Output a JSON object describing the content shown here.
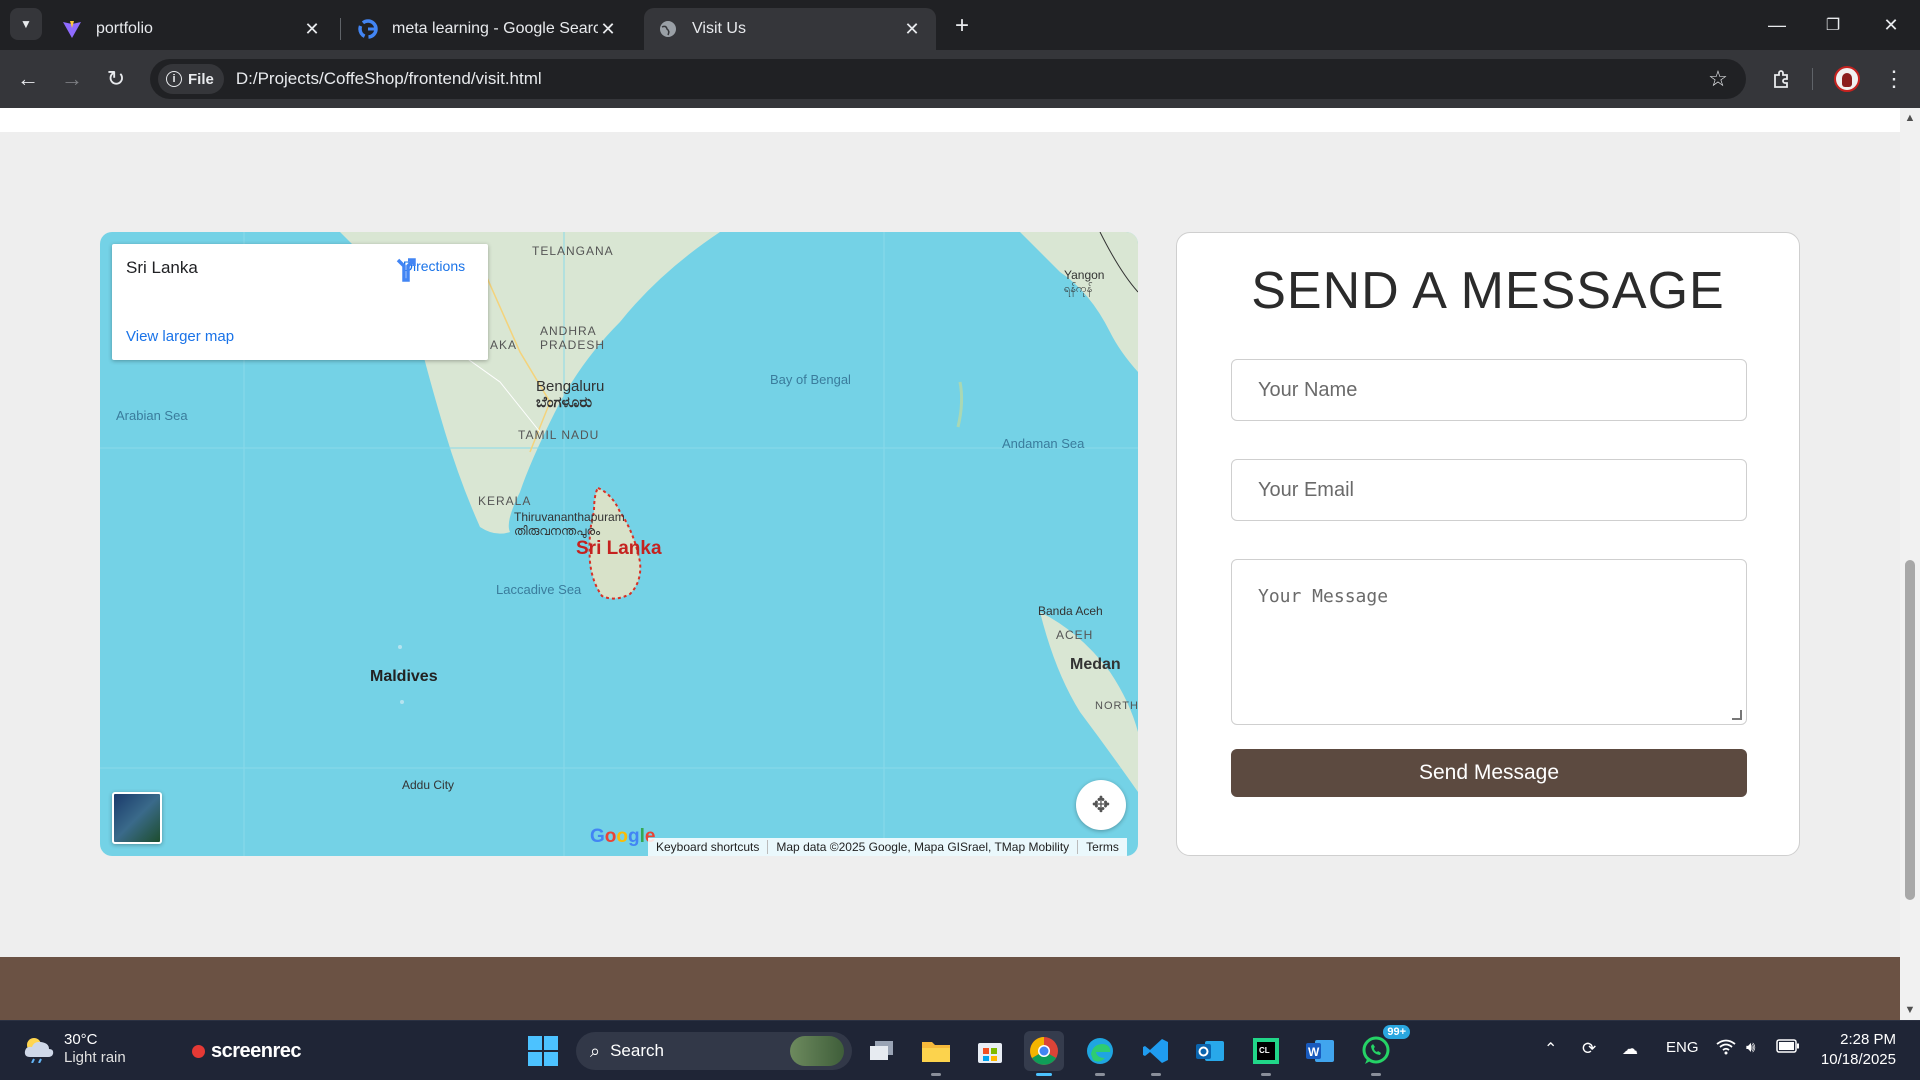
{
  "browser": {
    "tabs": [
      {
        "title": "portfolio",
        "favicon": "vite-icon"
      },
      {
        "title": "meta learning - Google Search",
        "favicon": "google-icon"
      },
      {
        "title": "Visit Us",
        "favicon": "globe-icon",
        "active": true
      }
    ],
    "scheme_chip": "File",
    "url": "D:/Projects/CoffeShop/frontend/visit.html"
  },
  "map": {
    "card": {
      "place_name": "Sri Lanka",
      "directions_label": "Directions",
      "larger_map_link": "View larger map"
    },
    "labels": {
      "telangana": "TELANGANA",
      "andhra": "ANDHRA",
      "pradesh": "PRADESH",
      "aka": "AKA",
      "bengaluru": "Bengaluru",
      "bengaluru_kn": "ಬೆಂಗಳೂರು",
      "tamil_nadu": "TAMIL NADU",
      "kerala": "KERALA",
      "thiruvananthapuram": "Thiruvananthapuram",
      "thiruvananthapuram_ml": "തിരുവനന്തപുരം",
      "sri_lanka": "Sri Lanka",
      "arabian_sea": "Arabian Sea",
      "bay_of_bengal": "Bay of Bengal",
      "andaman_sea": "Andaman Sea",
      "laccadive_sea": "Laccadive Sea",
      "maldives": "Maldives",
      "addu_city": "Addu City",
      "yangon": "Yangon",
      "yangon_my": "ရန်ကုန်",
      "banda_aceh": "Banda Aceh",
      "aceh": "ACEH",
      "medan": "Medan",
      "north": "NORTH"
    },
    "google_logo": "Google",
    "footer": {
      "shortcuts": "Keyboard shortcuts",
      "map_data": "Map data ©2025 Google, Mapa GISrael, TMap Mobility",
      "terms": "Terms"
    }
  },
  "form": {
    "title": "SEND A MESSAGE",
    "name_placeholder": "Your Name",
    "email_placeholder": "Your Email",
    "message_placeholder": "Your Message",
    "submit_label": "Send Message"
  },
  "taskbar": {
    "weather_temp": "30°C",
    "weather_condition": "Light rain",
    "screenrec_label": "screenrec",
    "search_label": "Search",
    "whatsapp_badge": "99+",
    "language": "ENG",
    "time": "2:28 PM",
    "date": "10/18/2025"
  },
  "colors": {
    "accent_button": "#5c4a40",
    "footer_brown": "#6b5244",
    "map_water": "#74d2e6",
    "map_land": "#d9e6d3"
  }
}
